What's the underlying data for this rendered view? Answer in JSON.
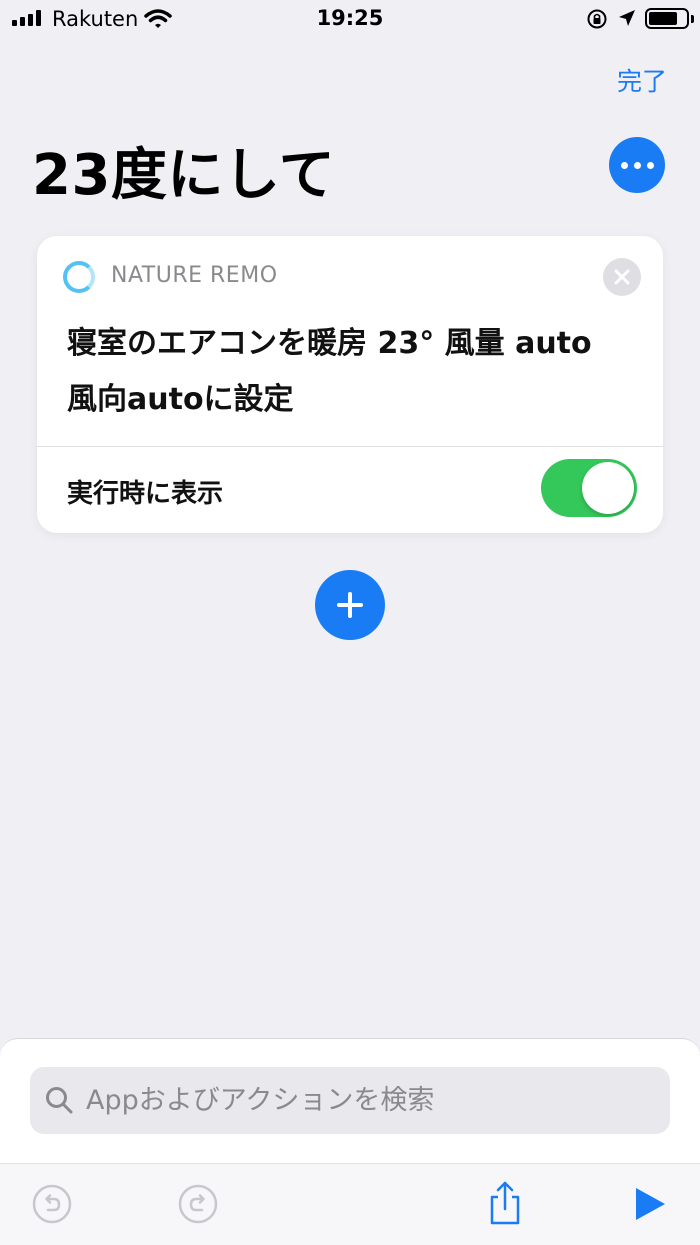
{
  "status": {
    "carrier": "Rakuten",
    "time": "19:25"
  },
  "nav": {
    "done_label": "完了",
    "title": "23度にして"
  },
  "action": {
    "app_name": "NATURE REMO",
    "description": "寝室のエアコンを暖房 23° 風量 auto 風向autoに設定",
    "toggle_label": "実行時に表示",
    "toggle_on": true
  },
  "search": {
    "placeholder": "Appおよびアクションを検索"
  },
  "colors": {
    "accent": "#1a7cf5",
    "toggle_on": "#34c759",
    "background": "#efeff4"
  },
  "icons": [
    "signal-icon",
    "wifi-icon",
    "rotation-lock-icon",
    "location-icon",
    "battery-icon",
    "more-icon",
    "close-icon",
    "plus-icon",
    "search-icon",
    "undo-icon",
    "redo-icon",
    "share-icon",
    "play-icon"
  ]
}
